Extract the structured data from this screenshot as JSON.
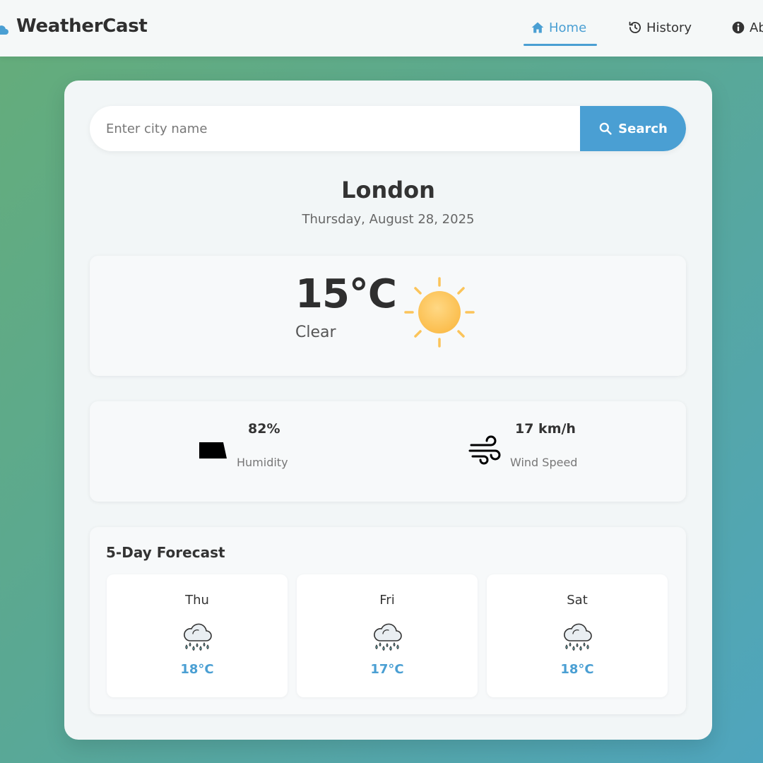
{
  "nav": {
    "brand": "WeatherCast",
    "links": [
      {
        "label": "Home",
        "icon": "home-icon",
        "active": true
      },
      {
        "label": "History",
        "icon": "history-icon",
        "active": false
      },
      {
        "label": "Ab",
        "icon": "info-icon",
        "active": false
      }
    ]
  },
  "search": {
    "placeholder": "Enter city name",
    "value": "",
    "button_label": "Search",
    "button_icon": "search-icon"
  },
  "location": {
    "city": "London",
    "date": "Thursday, August 28, 2025"
  },
  "current": {
    "temperature": "15°C",
    "condition": "Clear",
    "icon": "sun-icon"
  },
  "details": {
    "humidity": {
      "value": "82%",
      "label": "Humidity",
      "icon": "humidity-icon"
    },
    "wind": {
      "value": "17 km/h",
      "label": "Wind Speed",
      "icon": "wind-icon"
    }
  },
  "forecast": {
    "title": "5-Day Forecast",
    "days": [
      {
        "day": "Thu",
        "temp": "18°C",
        "icon": "rain-cloud-icon"
      },
      {
        "day": "Fri",
        "temp": "17°C",
        "icon": "rain-cloud-icon"
      },
      {
        "day": "Sat",
        "temp": "18°C",
        "icon": "rain-cloud-icon"
      }
    ]
  },
  "colors": {
    "accent": "#4a9fd3",
    "sun": "#fbc45a",
    "background_start": "#65ad79",
    "background_end": "#4fa5be"
  }
}
